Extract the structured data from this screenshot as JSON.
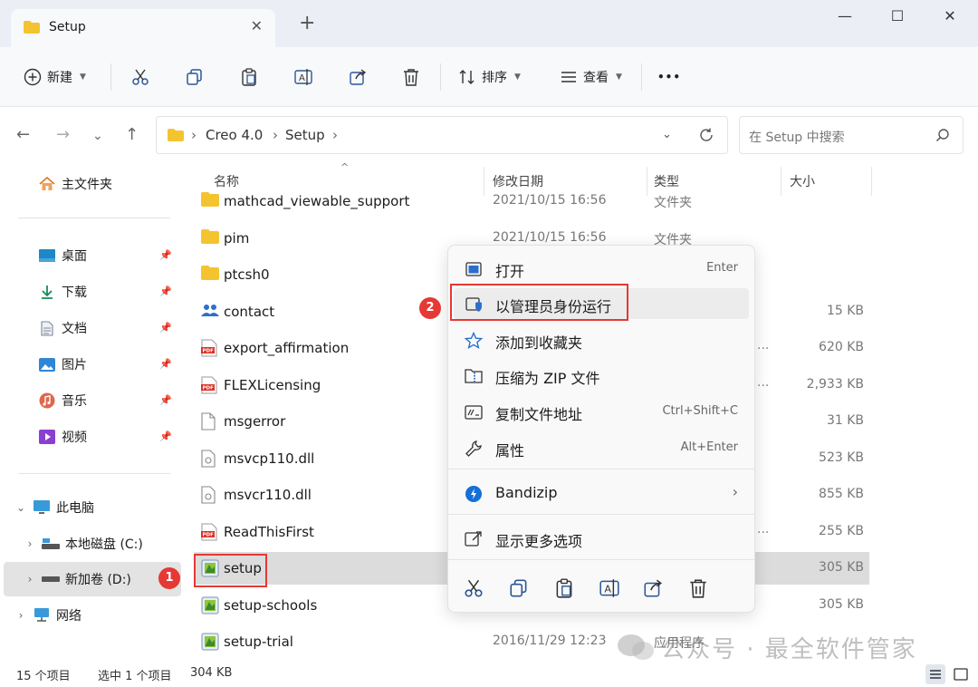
{
  "window": {
    "tab_title": "Setup",
    "tab_close": "✕",
    "new_tab": "+",
    "minimize": "—",
    "maximize": "☐",
    "close": "✕"
  },
  "toolbar": {
    "new_label": "新建",
    "sort_label": "排序",
    "view_label": "查看",
    "more_label": "•••"
  },
  "address": {
    "crumbs": [
      "Creo 4.0",
      "Setup"
    ],
    "search_placeholder": "在 Setup 中搜索"
  },
  "sidebar": {
    "home": "主文件夹",
    "quick": [
      {
        "label": "桌面",
        "icon": "desktop-icon"
      },
      {
        "label": "下载",
        "icon": "download-icon"
      },
      {
        "label": "文档",
        "icon": "documents-icon"
      },
      {
        "label": "图片",
        "icon": "pictures-icon"
      },
      {
        "label": "音乐",
        "icon": "music-icon"
      },
      {
        "label": "视频",
        "icon": "videos-icon"
      }
    ],
    "this_pc": "此电脑",
    "drives": [
      {
        "label": "本地磁盘 (C:)"
      },
      {
        "label": "新加卷 (D:)"
      }
    ],
    "network": "网络"
  },
  "columns": {
    "name": "名称",
    "date": "修改日期",
    "type": "类型",
    "size": "大小"
  },
  "files": [
    {
      "name": "mathcad_viewable_support",
      "date": "2021/10/15 16:56",
      "type": "文件夹",
      "size": "",
      "icon": "folder-icon"
    },
    {
      "name": "pim",
      "date": "2021/10/15 16:56",
      "type": "文件夹",
      "size": "",
      "icon": "folder-icon"
    },
    {
      "name": "ptcsh0",
      "date": "",
      "type": "",
      "size": "",
      "icon": "folder-icon"
    },
    {
      "name": "contact",
      "date": "",
      "type": "",
      "size": "15 KB",
      "icon": "contact-icon"
    },
    {
      "name": "export_affirmation",
      "date": "",
      "type": "",
      "size": "620 KB",
      "icon": "pdf-icon",
      "dots": "..."
    },
    {
      "name": "FLEXLicensing",
      "date": "",
      "type": "",
      "size": "2,933 KB",
      "icon": "pdf-icon",
      "dots": "..."
    },
    {
      "name": "msgerror",
      "date": "",
      "type": "",
      "size": "31 KB",
      "icon": "file-icon"
    },
    {
      "name": "msvcp110.dll",
      "date": "",
      "type": "",
      "size": "523 KB",
      "icon": "dll-icon"
    },
    {
      "name": "msvcr110.dll",
      "date": "",
      "type": "",
      "size": "855 KB",
      "icon": "dll-icon"
    },
    {
      "name": "ReadThisFirst",
      "date": "",
      "type": "",
      "size": "255 KB",
      "icon": "pdf-icon",
      "dots": "..."
    },
    {
      "name": "setup",
      "date": "",
      "type": "",
      "size": "305 KB",
      "icon": "setup-icon"
    },
    {
      "name": "setup-schools",
      "date": "",
      "type": "",
      "size": "305 KB",
      "icon": "setup-icon"
    },
    {
      "name": "setup-trial",
      "date": "2016/11/29 12:23",
      "type": "应用程序",
      "size": "",
      "icon": "setup-icon"
    }
  ],
  "context_menu": {
    "items": [
      {
        "label": "打开",
        "shortcut": "Enter",
        "icon": "open-icon"
      },
      {
        "label": "以管理员身份运行",
        "shortcut": "",
        "icon": "shield-icon"
      },
      {
        "label": "添加到收藏夹",
        "shortcut": "",
        "icon": "star-icon"
      },
      {
        "label": "压缩为 ZIP 文件",
        "shortcut": "",
        "icon": "zip-icon"
      },
      {
        "label": "复制文件地址",
        "shortcut": "Ctrl+Shift+C",
        "icon": "copy-path-icon"
      },
      {
        "label": "属性",
        "shortcut": "Alt+Enter",
        "icon": "wrench-icon"
      },
      {
        "label": "Bandizip",
        "shortcut": "›",
        "icon": "bandizip-icon"
      },
      {
        "label": "显示更多选项",
        "shortcut": "",
        "icon": "more-options-icon"
      }
    ]
  },
  "annotations": {
    "badge1": "1",
    "badge2": "2"
  },
  "status": {
    "count": "15 个项目",
    "selected": "选中 1 个项目",
    "selected_size": "304 KB"
  },
  "watermark": "公众号 · 最全软件管家",
  "colors": {
    "accent": "#0067c0",
    "highlight_red": "#e53935",
    "folder_yellow": "#f4c430"
  }
}
